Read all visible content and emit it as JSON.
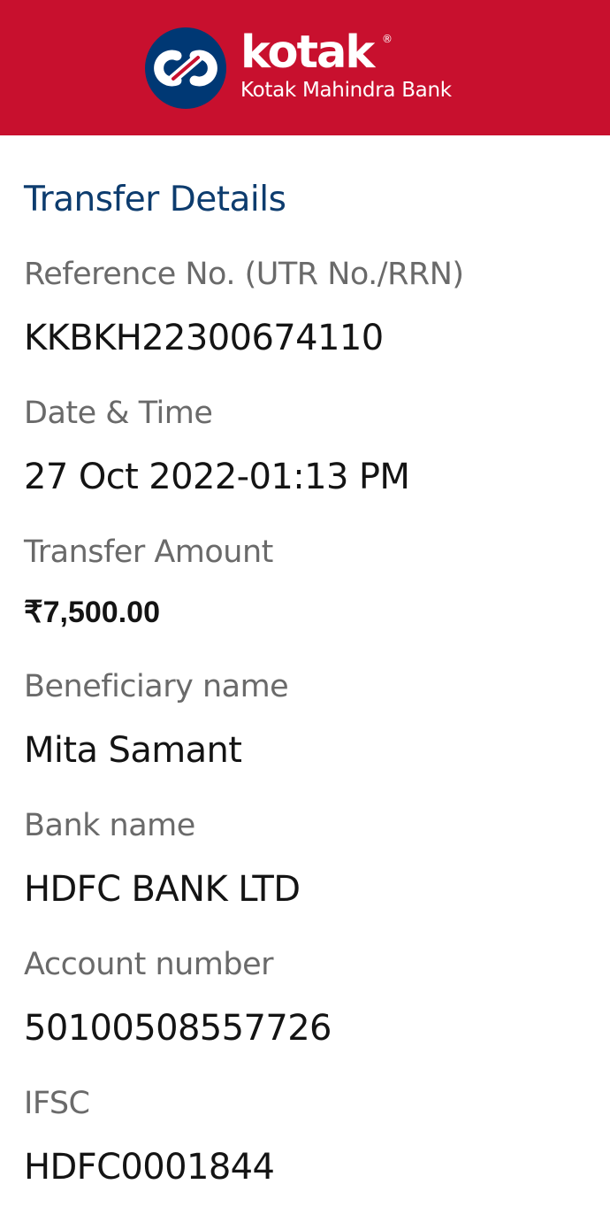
{
  "header": {
    "brand": "kotak",
    "registered_mark": "®",
    "subtitle": "Kotak Mahindra Bank",
    "logo_icon": "kotak-infinity-logo-icon",
    "colors": {
      "header_bg": "#c8102e",
      "logo_circle": "#003874",
      "title": "#0d3c6e"
    }
  },
  "transfer": {
    "title": "Transfer Details",
    "reference_label": "Reference No. (UTR No./RRN)",
    "reference_value": "KKBKH22300674110",
    "datetime_label": "Date & Time",
    "datetime_value": "27 Oct 2022-01:13 PM",
    "amount_label": "Transfer Amount",
    "amount_value": "₹7,500.00",
    "beneficiary_label": "Beneficiary name",
    "beneficiary_value": "Mita Samant",
    "bank_label": "Bank name",
    "bank_value": "HDFC BANK LTD",
    "account_label": "Account number",
    "account_value": "50100508557726",
    "ifsc_label": "IFSC",
    "ifsc_value": "HDFC0001844"
  }
}
